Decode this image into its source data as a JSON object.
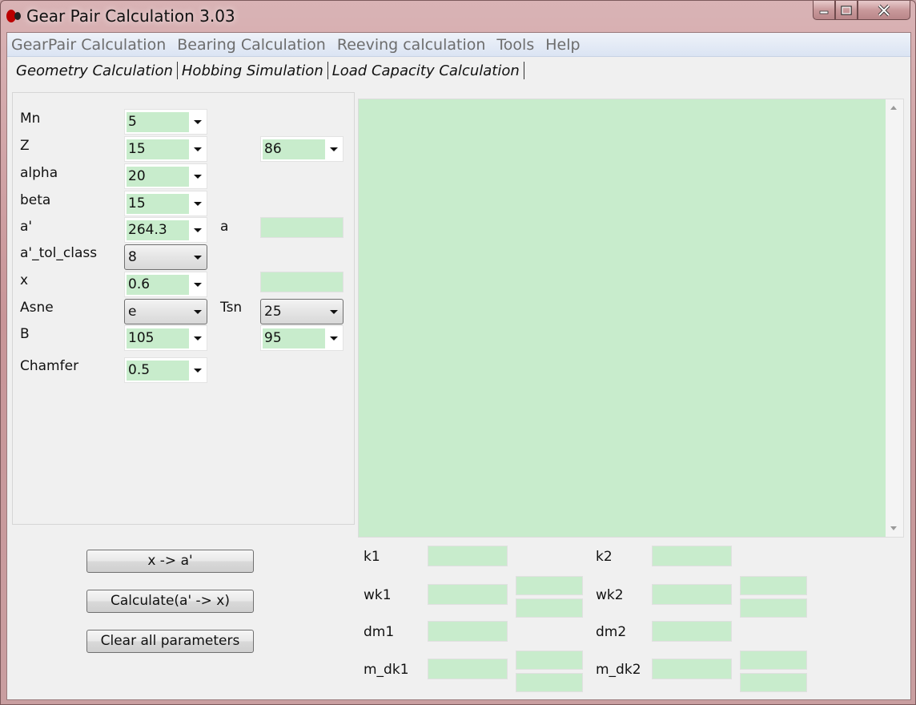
{
  "window": {
    "title": "Gear Pair Calculation 3.03"
  },
  "menu": [
    "GearPair Calculation",
    "Bearing Calculation",
    "Reeving calculation",
    "Tools",
    "Help"
  ],
  "tabs": [
    "Geometry Calculation",
    "Hobbing Simulation",
    "Load Capacity Calculation"
  ],
  "params": {
    "mn": {
      "label": "Mn",
      "value": "5"
    },
    "z": {
      "label": "Z",
      "value1": "15",
      "value2": "86"
    },
    "alpha": {
      "label": "alpha",
      "value": "20"
    },
    "beta": {
      "label": "beta",
      "value": "15"
    },
    "a_prime": {
      "label": "a'",
      "value": "264.3"
    },
    "a": {
      "label": "a",
      "value": ""
    },
    "a_tol_class": {
      "label": "a'_tol_class",
      "value": "8"
    },
    "x": {
      "label": "x",
      "value": "0.6",
      "value2": ""
    },
    "asne": {
      "label": "Asne",
      "value": "e"
    },
    "tsn": {
      "label": "Tsn",
      "value": "25"
    },
    "b": {
      "label": "B",
      "value1": "105",
      "value2": "95"
    },
    "chamfer": {
      "label": "Chamfer",
      "value": "0.5"
    }
  },
  "buttons": {
    "x_to_a": "x -> a'",
    "calculate": "Calculate(a' -> x)",
    "clear": "Clear all parameters"
  },
  "results": {
    "k1": "k1",
    "k2": "k2",
    "wk1": "wk1",
    "wk2": "wk2",
    "dm1": "dm1",
    "dm2": "dm2",
    "m_dk1": "m_dk1",
    "m_dk2": "m_dk2"
  },
  "colors": {
    "field_bg": "#c8eccc",
    "client_bg": "#f0f0f0"
  }
}
